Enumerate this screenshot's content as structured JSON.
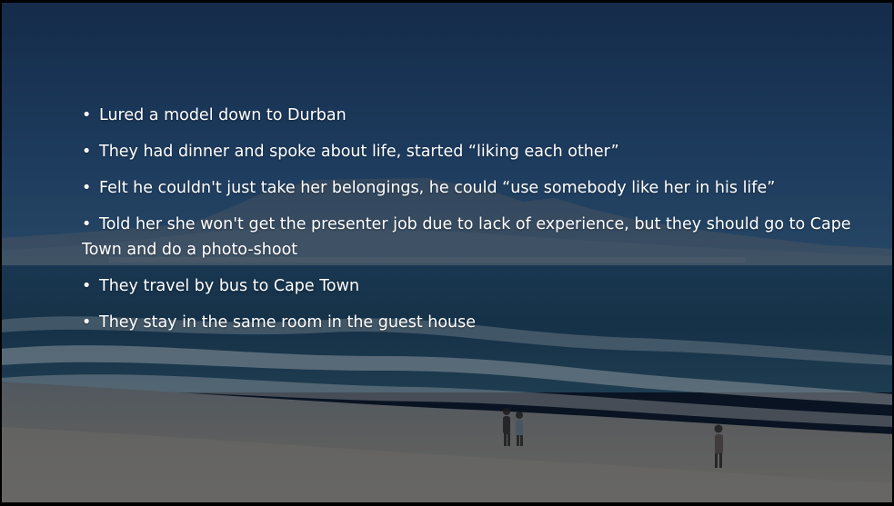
{
  "slide": {
    "bullet_glyph": "•",
    "bullets": [
      "Lured a model down to Durban",
      "They had dinner and spoke about life, started “liking each other”",
      "Felt he couldn't just take her belongings, he could “use somebody like her in his life”",
      " Told her she won't get the presenter job due to lack of experience, but they should go to Cape Town and do a photo-shoot",
      "They travel by bus to Cape Town",
      "They stay in the same room in the guest house"
    ]
  },
  "colors": {
    "text": "#ffffff",
    "sky": "#2a4f7a",
    "sea": "#1f4763",
    "sand": "#8d8a84"
  },
  "icons": {
    "background": "beach-photo-icon"
  }
}
